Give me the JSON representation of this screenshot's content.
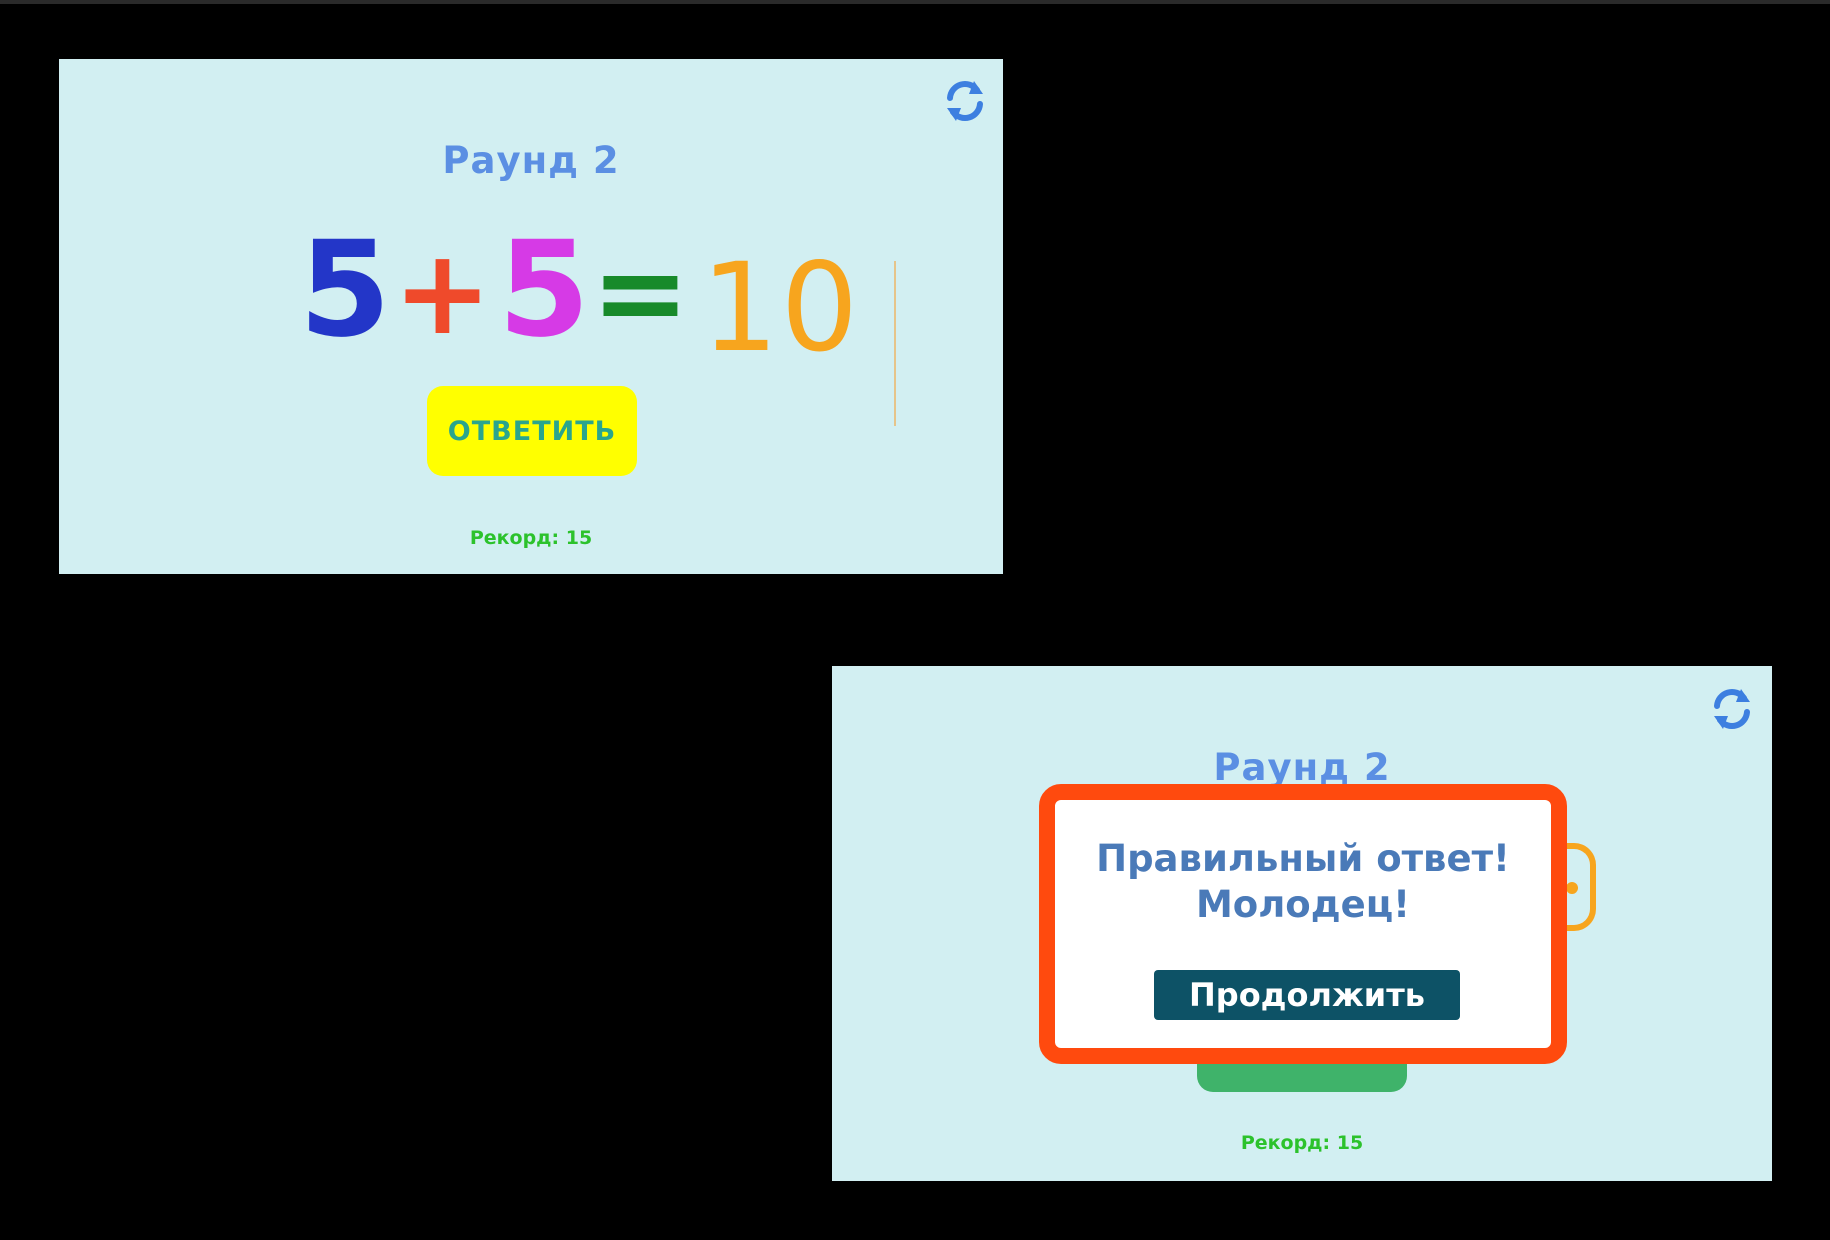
{
  "screen_before": {
    "round_title": "Раунд 2",
    "equation": {
      "operand1": "5",
      "operator": "+",
      "operand2": "5",
      "equals": "=",
      "answer_input": "10"
    },
    "answer_button_label": "ОТВЕТИТЬ",
    "record_text": "Рекорд: 15",
    "refresh_icon": "refresh-icon"
  },
  "screen_after": {
    "round_title": "Раунд 2",
    "dialog": {
      "message_line1": "Правильный ответ!",
      "message_line2": "Молодец!",
      "continue_button_label": "Продолжить"
    },
    "record_text": "Рекорд: 15",
    "refresh_icon": "refresh-icon"
  },
  "colors": {
    "screen_background": "#d2eff2",
    "round_title": "#5b8fe3",
    "operand1": "#2336c8",
    "operator": "#ef4a2b",
    "operand2": "#d63ae6",
    "equals": "#178a2a",
    "answer": "#f7a51e",
    "answer_button_bg": "#ffff00",
    "answer_button_text": "#2aa58d",
    "record": "#2cc22c",
    "dialog_border": "#ff4a0e",
    "dialog_text": "#4a7ab8",
    "continue_button_bg": "#0d5266"
  }
}
